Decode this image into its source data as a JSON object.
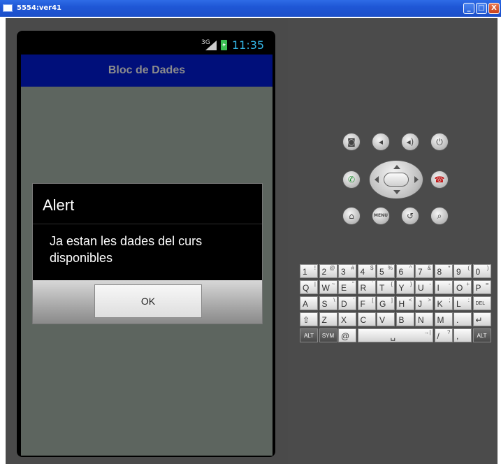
{
  "window": {
    "title": "5554:ver41",
    "minimize_label": "_",
    "maximize_label": "□",
    "close_label": "X"
  },
  "status_bar": {
    "network": "3G",
    "time": "11:35"
  },
  "app": {
    "title": "Bloc de Dades"
  },
  "dialog": {
    "title": "Alert",
    "message": "Ja estan les dades del curs disponibles",
    "ok_label": "OK"
  },
  "hardware": {
    "buttons": [
      "camera-icon",
      "volume-down-icon",
      "volume-up-icon",
      "power-icon",
      "call-icon",
      "end-call-icon",
      "home-icon",
      "menu-icon",
      "back-icon",
      "search-icon"
    ],
    "menu_label": "MENU"
  },
  "keyboard": {
    "row1": [
      {
        "k": "1",
        "a": "!"
      },
      {
        "k": "2",
        "a": "@"
      },
      {
        "k": "3",
        "a": "#"
      },
      {
        "k": "4",
        "a": "$"
      },
      {
        "k": "5",
        "a": "%"
      },
      {
        "k": "6",
        "a": "^"
      },
      {
        "k": "7",
        "a": "&"
      },
      {
        "k": "8",
        "a": "*"
      },
      {
        "k": "9",
        "a": "("
      },
      {
        "k": "0",
        "a": ")"
      }
    ],
    "row2": [
      {
        "k": "Q",
        "a": "|"
      },
      {
        "k": "W",
        "a": "~"
      },
      {
        "k": "E",
        "a": "\""
      },
      {
        "k": "R",
        "a": "`"
      },
      {
        "k": "T",
        "a": "{"
      },
      {
        "k": "Y",
        "a": "}"
      },
      {
        "k": "U",
        "a": "-"
      },
      {
        "k": "I",
        "a": "-"
      },
      {
        "k": "O",
        "a": "+"
      },
      {
        "k": "P",
        "a": "="
      }
    ],
    "row3": [
      {
        "k": "A",
        "a": ""
      },
      {
        "k": "S",
        "a": "\\"
      },
      {
        "k": "D",
        "a": "'"
      },
      {
        "k": "F",
        "a": "["
      },
      {
        "k": "G",
        "a": "]"
      },
      {
        "k": "H",
        "a": "<"
      },
      {
        "k": "J",
        "a": ">"
      },
      {
        "k": "K",
        "a": ";"
      },
      {
        "k": "L",
        "a": ":"
      },
      {
        "k": "DEL",
        "a": ""
      }
    ],
    "row4": [
      {
        "k": "⇧",
        "a": ""
      },
      {
        "k": "Z",
        "a": ""
      },
      {
        "k": "X",
        "a": ""
      },
      {
        "k": "C",
        "a": ""
      },
      {
        "k": "V",
        "a": ""
      },
      {
        "k": "B",
        "a": ""
      },
      {
        "k": "N",
        "a": ""
      },
      {
        "k": "M",
        "a": ""
      },
      {
        "k": ".",
        "a": ""
      },
      {
        "k": "↵",
        "a": ""
      }
    ],
    "row5": [
      {
        "k": "ALT",
        "a": ""
      },
      {
        "k": "SYM",
        "a": ""
      },
      {
        "k": "@",
        "a": ""
      },
      {
        "k": "␣",
        "a": "→|"
      },
      {
        "k": "/",
        "a": "?"
      },
      {
        "k": ",",
        "a": ""
      },
      {
        "k": "ALT",
        "a": ""
      }
    ]
  }
}
